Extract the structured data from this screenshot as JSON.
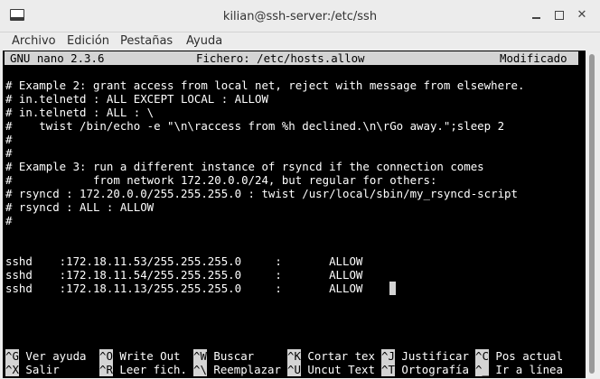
{
  "window": {
    "title": "kilian@ssh-server:/etc/ssh",
    "app_icon": "terminal-icon",
    "controls": {
      "minimize": "_",
      "maximize": "□",
      "close": "✕"
    }
  },
  "menu": [
    "Archivo",
    "Edición",
    "Pestañas",
    "Ayuda"
  ],
  "nano": {
    "version": "GNU nano 2.3.6",
    "file": "Fichero: /etc/hosts.allow",
    "status": "Modificado",
    "lines": [
      "# Example 2: grant access from local net, reject with message from elsewhere.",
      "# in.telnetd : ALL EXCEPT LOCAL : ALLOW",
      "# in.telnetd : ALL : \\",
      "#    twist /bin/echo -e \"\\n\\raccess from %h declined.\\n\\rGo away.\";sleep 2",
      "#",
      "#",
      "# Example 3: run a different instance of rsyncd if the connection comes",
      "#            from network 172.20.0.0/24, but regular for others:",
      "# rsyncd : 172.20.0.0/255.255.255.0 : twist /usr/local/sbin/my_rsyncd-script",
      "# rsyncd : ALL : ALLOW",
      "#",
      "",
      "",
      "sshd    :172.18.11.53/255.255.255.0     :       ALLOW",
      "sshd    :172.18.11.54/255.255.255.0     :       ALLOW",
      "sshd    :172.18.11.13/255.255.255.0     :       ALLOW"
    ],
    "shortcuts_row1": [
      {
        "key": "^G",
        "label": " Ver ayuda "
      },
      {
        "key": "^O",
        "label": " Write Out "
      },
      {
        "key": "^W",
        "label": " Buscar    "
      },
      {
        "key": "^K",
        "label": " Cortar tex"
      },
      {
        "key": "^J",
        "label": " Justificar"
      },
      {
        "key": "^C",
        "label": " Pos actual"
      }
    ],
    "shortcuts_row2": [
      {
        "key": "^X",
        "label": " Salir     "
      },
      {
        "key": "^R",
        "label": " Leer fich."
      },
      {
        "key": "^\\",
        "label": " Reemplazar"
      },
      {
        "key": "^U",
        "label": " Uncut Text"
      },
      {
        "key": "^T",
        "label": " Ortografía"
      },
      {
        "key": "^_",
        "label": " Ir a línea"
      }
    ]
  }
}
